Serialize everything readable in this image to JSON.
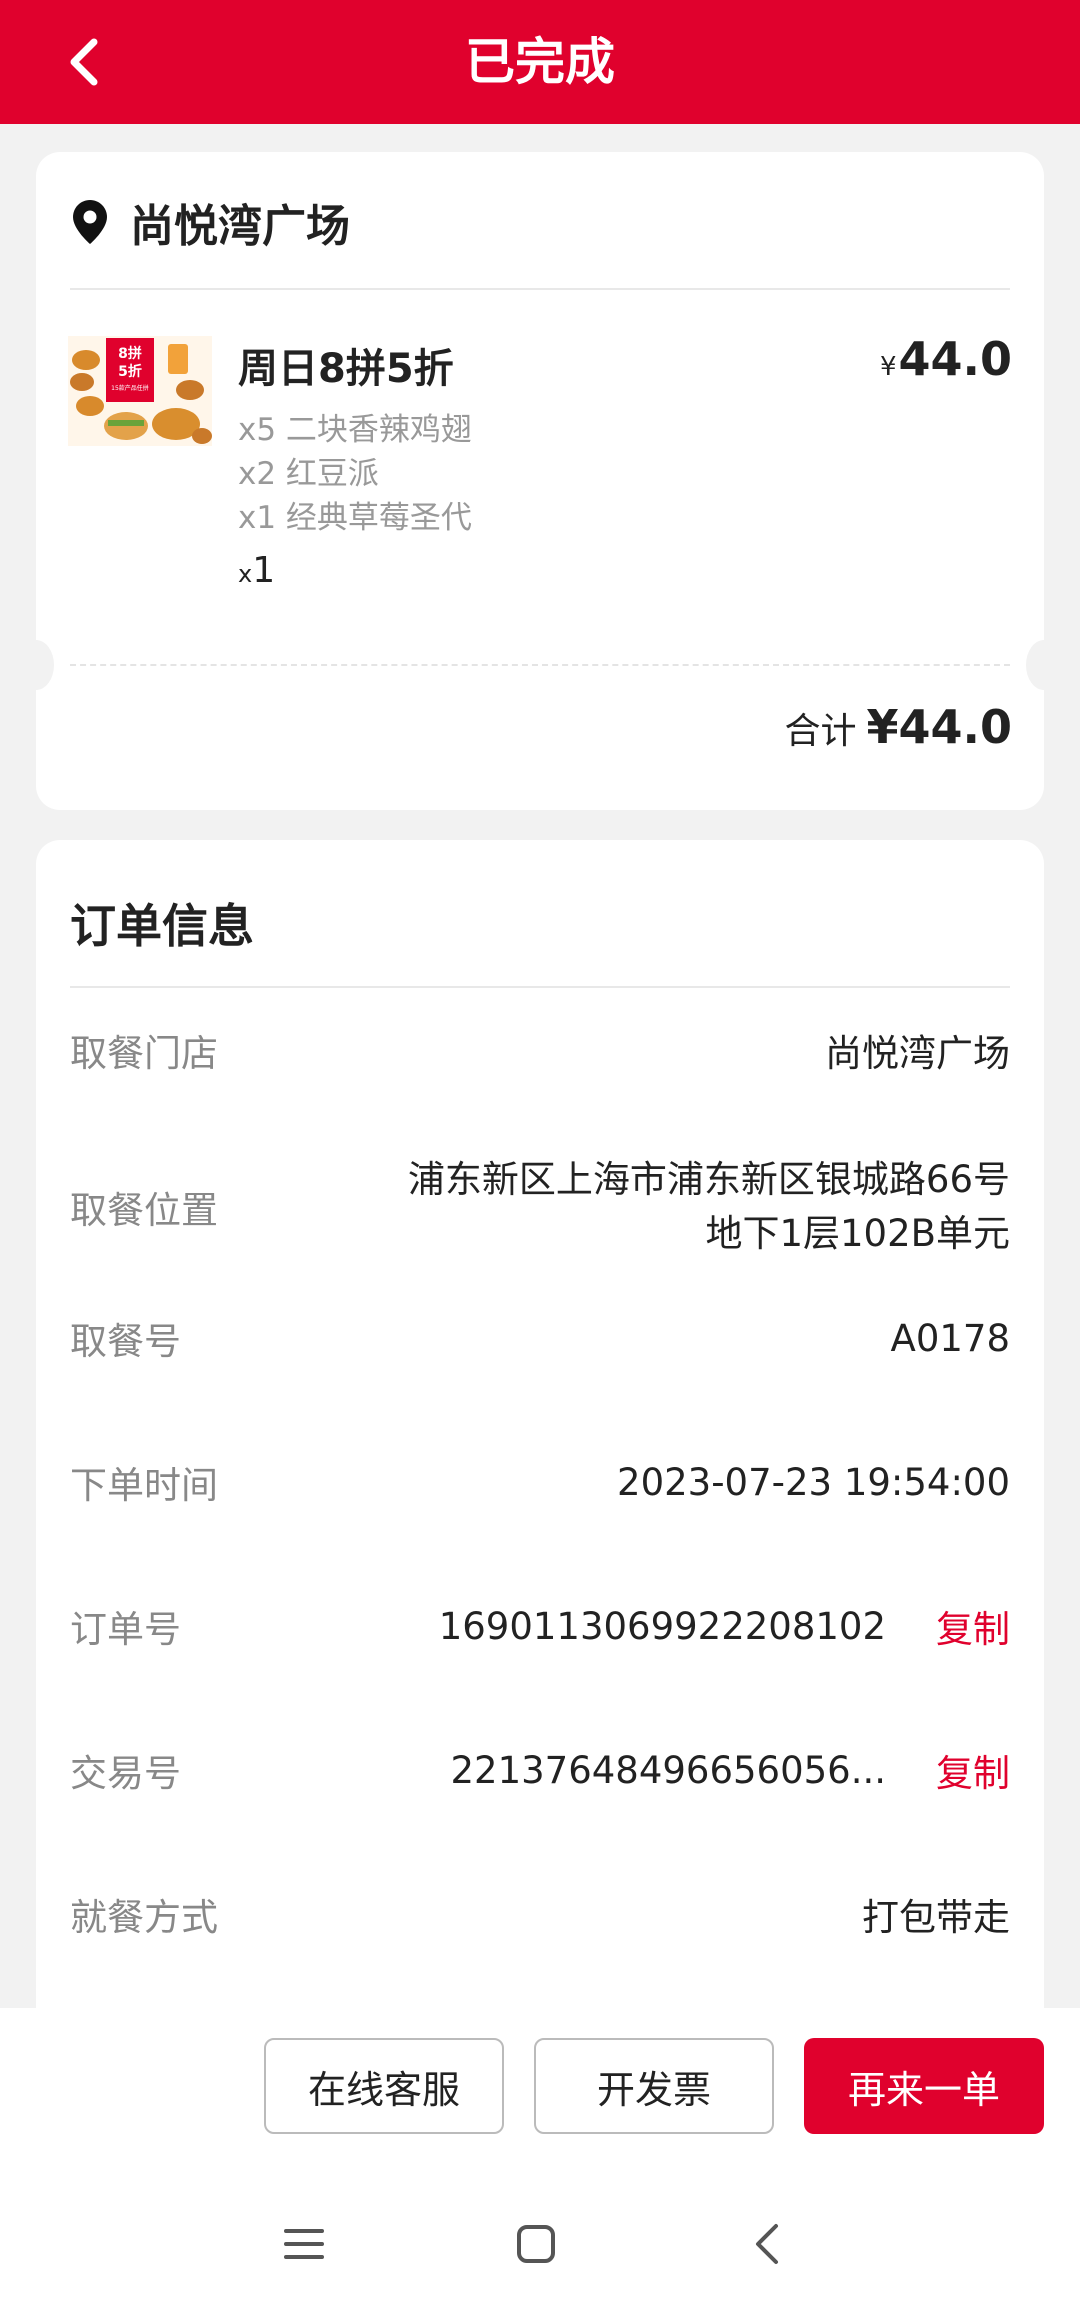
{
  "header": {
    "title": "已完成"
  },
  "store": {
    "name": "尚悦湾广场"
  },
  "product": {
    "name": "周日8拼5折",
    "price_symbol": "¥",
    "price": "44.0",
    "image_text": {
      "line1": "8拼",
      "line2": "5折",
      "line3": "15款产品任拼"
    },
    "sub_items": [
      "x5 二块香辣鸡翅",
      "x2 红豆派",
      "x1 经典草莓圣代"
    ],
    "qty_prefix": "x",
    "qty": "1"
  },
  "total": {
    "label": "合计",
    "amount": "¥44.0"
  },
  "order_info": {
    "title": "订单信息",
    "rows": [
      {
        "label": "取餐门店",
        "value": "尚悦湾广场"
      },
      {
        "label": "取餐位置",
        "value": "浦东新区上海市浦东新区银城路66号地下1层102B单元"
      },
      {
        "label": "取餐号",
        "value": "A0178"
      },
      {
        "label": "下单时间",
        "value": "2023-07-23 19:54:00"
      },
      {
        "label": "订单号",
        "value": "1690113069922208102",
        "action": "复制"
      },
      {
        "label": "交易号",
        "value": "22137648496656056...",
        "action": "复制"
      },
      {
        "label": "就餐方式",
        "value": "打包带走"
      }
    ]
  },
  "actions": {
    "customer_service": "在线客服",
    "invoice": "开发票",
    "reorder": "再来一单"
  },
  "colors": {
    "brand": "#e0012d",
    "background": "#f2f2f2"
  },
  "icons": [
    "back-arrow-icon",
    "location-pin-icon",
    "menu-icon",
    "home-icon",
    "nav-back-icon"
  ]
}
